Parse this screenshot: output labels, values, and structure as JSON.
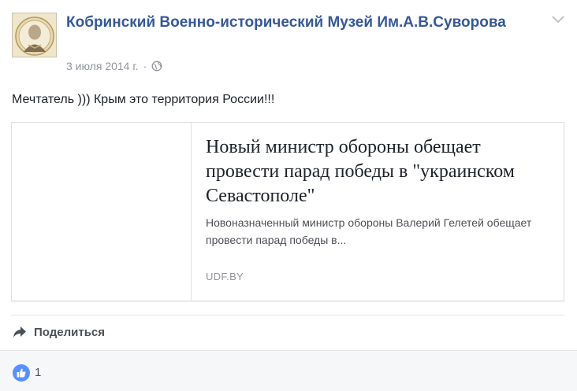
{
  "post": {
    "page_name": "Кобринский Военно-исторический Музей Им.А.В.Суворова",
    "date": "3 июля 2014 г.",
    "separator": "·",
    "privacy_icon": "globe-icon",
    "menu_icon": "chevron-down-icon",
    "message": "Мечтатель ))) Крым это территория России!!!"
  },
  "link_card": {
    "title": "Новый министр обороны обещает провести парад победы в \"украинском Севастополе\"",
    "description": "Новоназначенный министр обороны Валерий Гелетей обещает провести парад победы в...",
    "domain": "UDF.BY"
  },
  "actions": {
    "share_label": "Поделиться",
    "share_icon": "share-arrow-icon"
  },
  "reactions": {
    "like_icon": "thumbs-up-icon",
    "count": "1"
  },
  "colors": {
    "link_blue": "#365899",
    "like_blue": "#5890ff",
    "meta_gray": "#90949c",
    "footer_bg": "#f6f7f9"
  }
}
